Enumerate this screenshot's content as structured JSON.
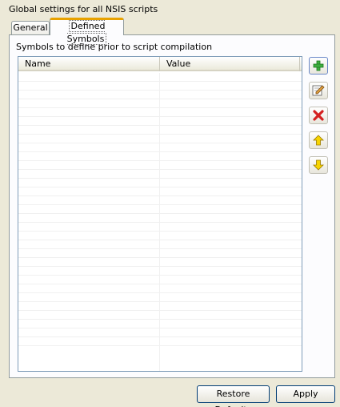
{
  "window": {
    "title": "Global settings for all NSIS scripts"
  },
  "tabs": [
    {
      "label": "General",
      "selected": false
    },
    {
      "label": "Defined Symbols",
      "selected": true
    }
  ],
  "panel": {
    "description": "Symbols to define prior to script compilation",
    "table": {
      "columns": [
        "Name",
        "Value"
      ],
      "rows": []
    },
    "toolbar": [
      {
        "icon": "add-icon",
        "color": "#2e9e2e"
      },
      {
        "icon": "edit-icon",
        "color": "#8a5a2b"
      },
      {
        "icon": "delete-icon",
        "color": "#d42020"
      },
      {
        "icon": "move-up-icon",
        "color": "#f2c300"
      },
      {
        "icon": "move-down-icon",
        "color": "#f2c300"
      }
    ]
  },
  "buttons": {
    "restore_defaults": "Restore Defaults",
    "apply": "Apply"
  }
}
